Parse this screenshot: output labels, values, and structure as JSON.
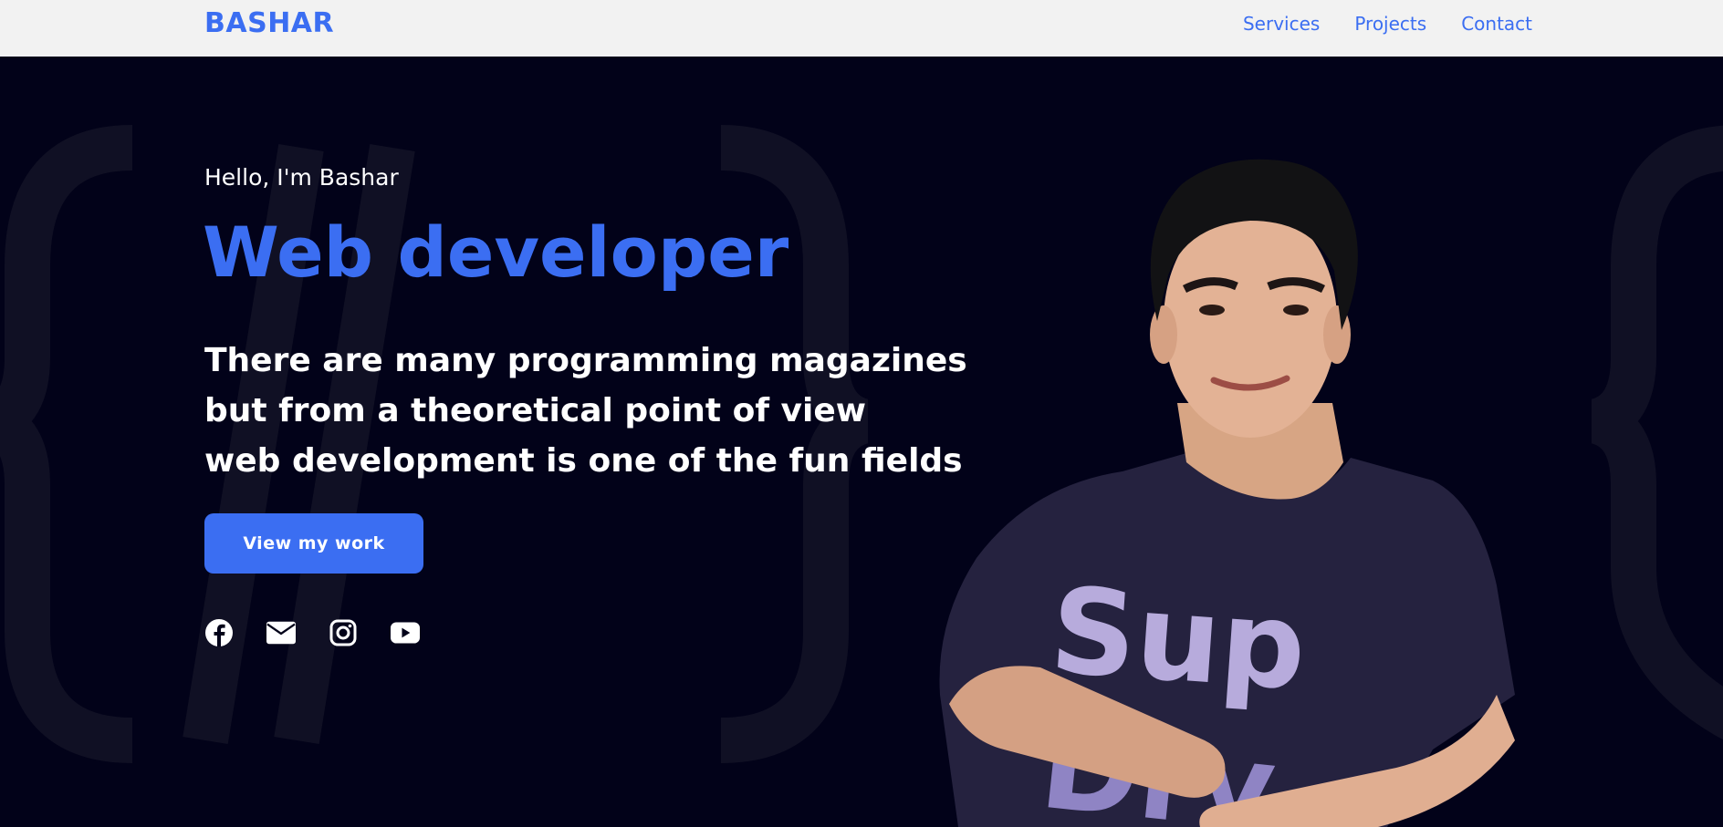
{
  "header": {
    "brand": "BASHAR",
    "nav": [
      {
        "label": "Services"
      },
      {
        "label": "Projects"
      },
      {
        "label": "Contact"
      }
    ]
  },
  "hero": {
    "greeting": "Hello, I'm Bashar",
    "role": "Web developer",
    "intro_lines": [
      "There are many programming magazines",
      "but from a theoretical point of view",
      "web development is one of the fun fields"
    ],
    "cta_label": "View my work",
    "socials": [
      {
        "icon": "facebook-icon"
      },
      {
        "icon": "envelope-icon"
      },
      {
        "icon": "instagram-icon"
      },
      {
        "icon": "youtube-icon"
      }
    ],
    "shirt_print": [
      "Sup",
      "Dry"
    ]
  },
  "colors": {
    "accent": "#3b6ef2",
    "background": "#020219",
    "header_bg": "#f2f2f2",
    "text": "#ffffff"
  }
}
